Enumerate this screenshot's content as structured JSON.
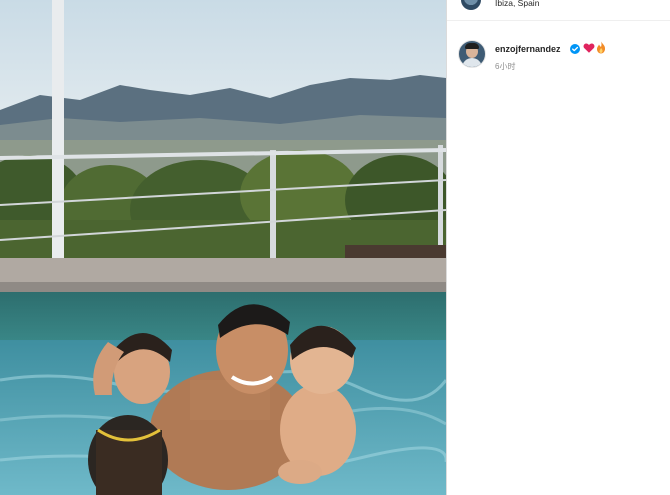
{
  "post": {
    "location": "Ibiza, Spain",
    "author": {
      "username": "enzojfernandez",
      "avatar_icon": "profile-avatar"
    },
    "caption_emojis": [
      "red-heart-icon",
      "fire-icon"
    ],
    "verified_icon": "verified-badge-icon",
    "timestamp": "6小时",
    "photo_description_icon": "post-photo"
  },
  "colors": {
    "verified_blue": "#0095f6",
    "heart_red": "#e0245e",
    "fire_orange": "#f28c28",
    "muted_text": "#8e8e8e",
    "primary_text": "#262626"
  }
}
